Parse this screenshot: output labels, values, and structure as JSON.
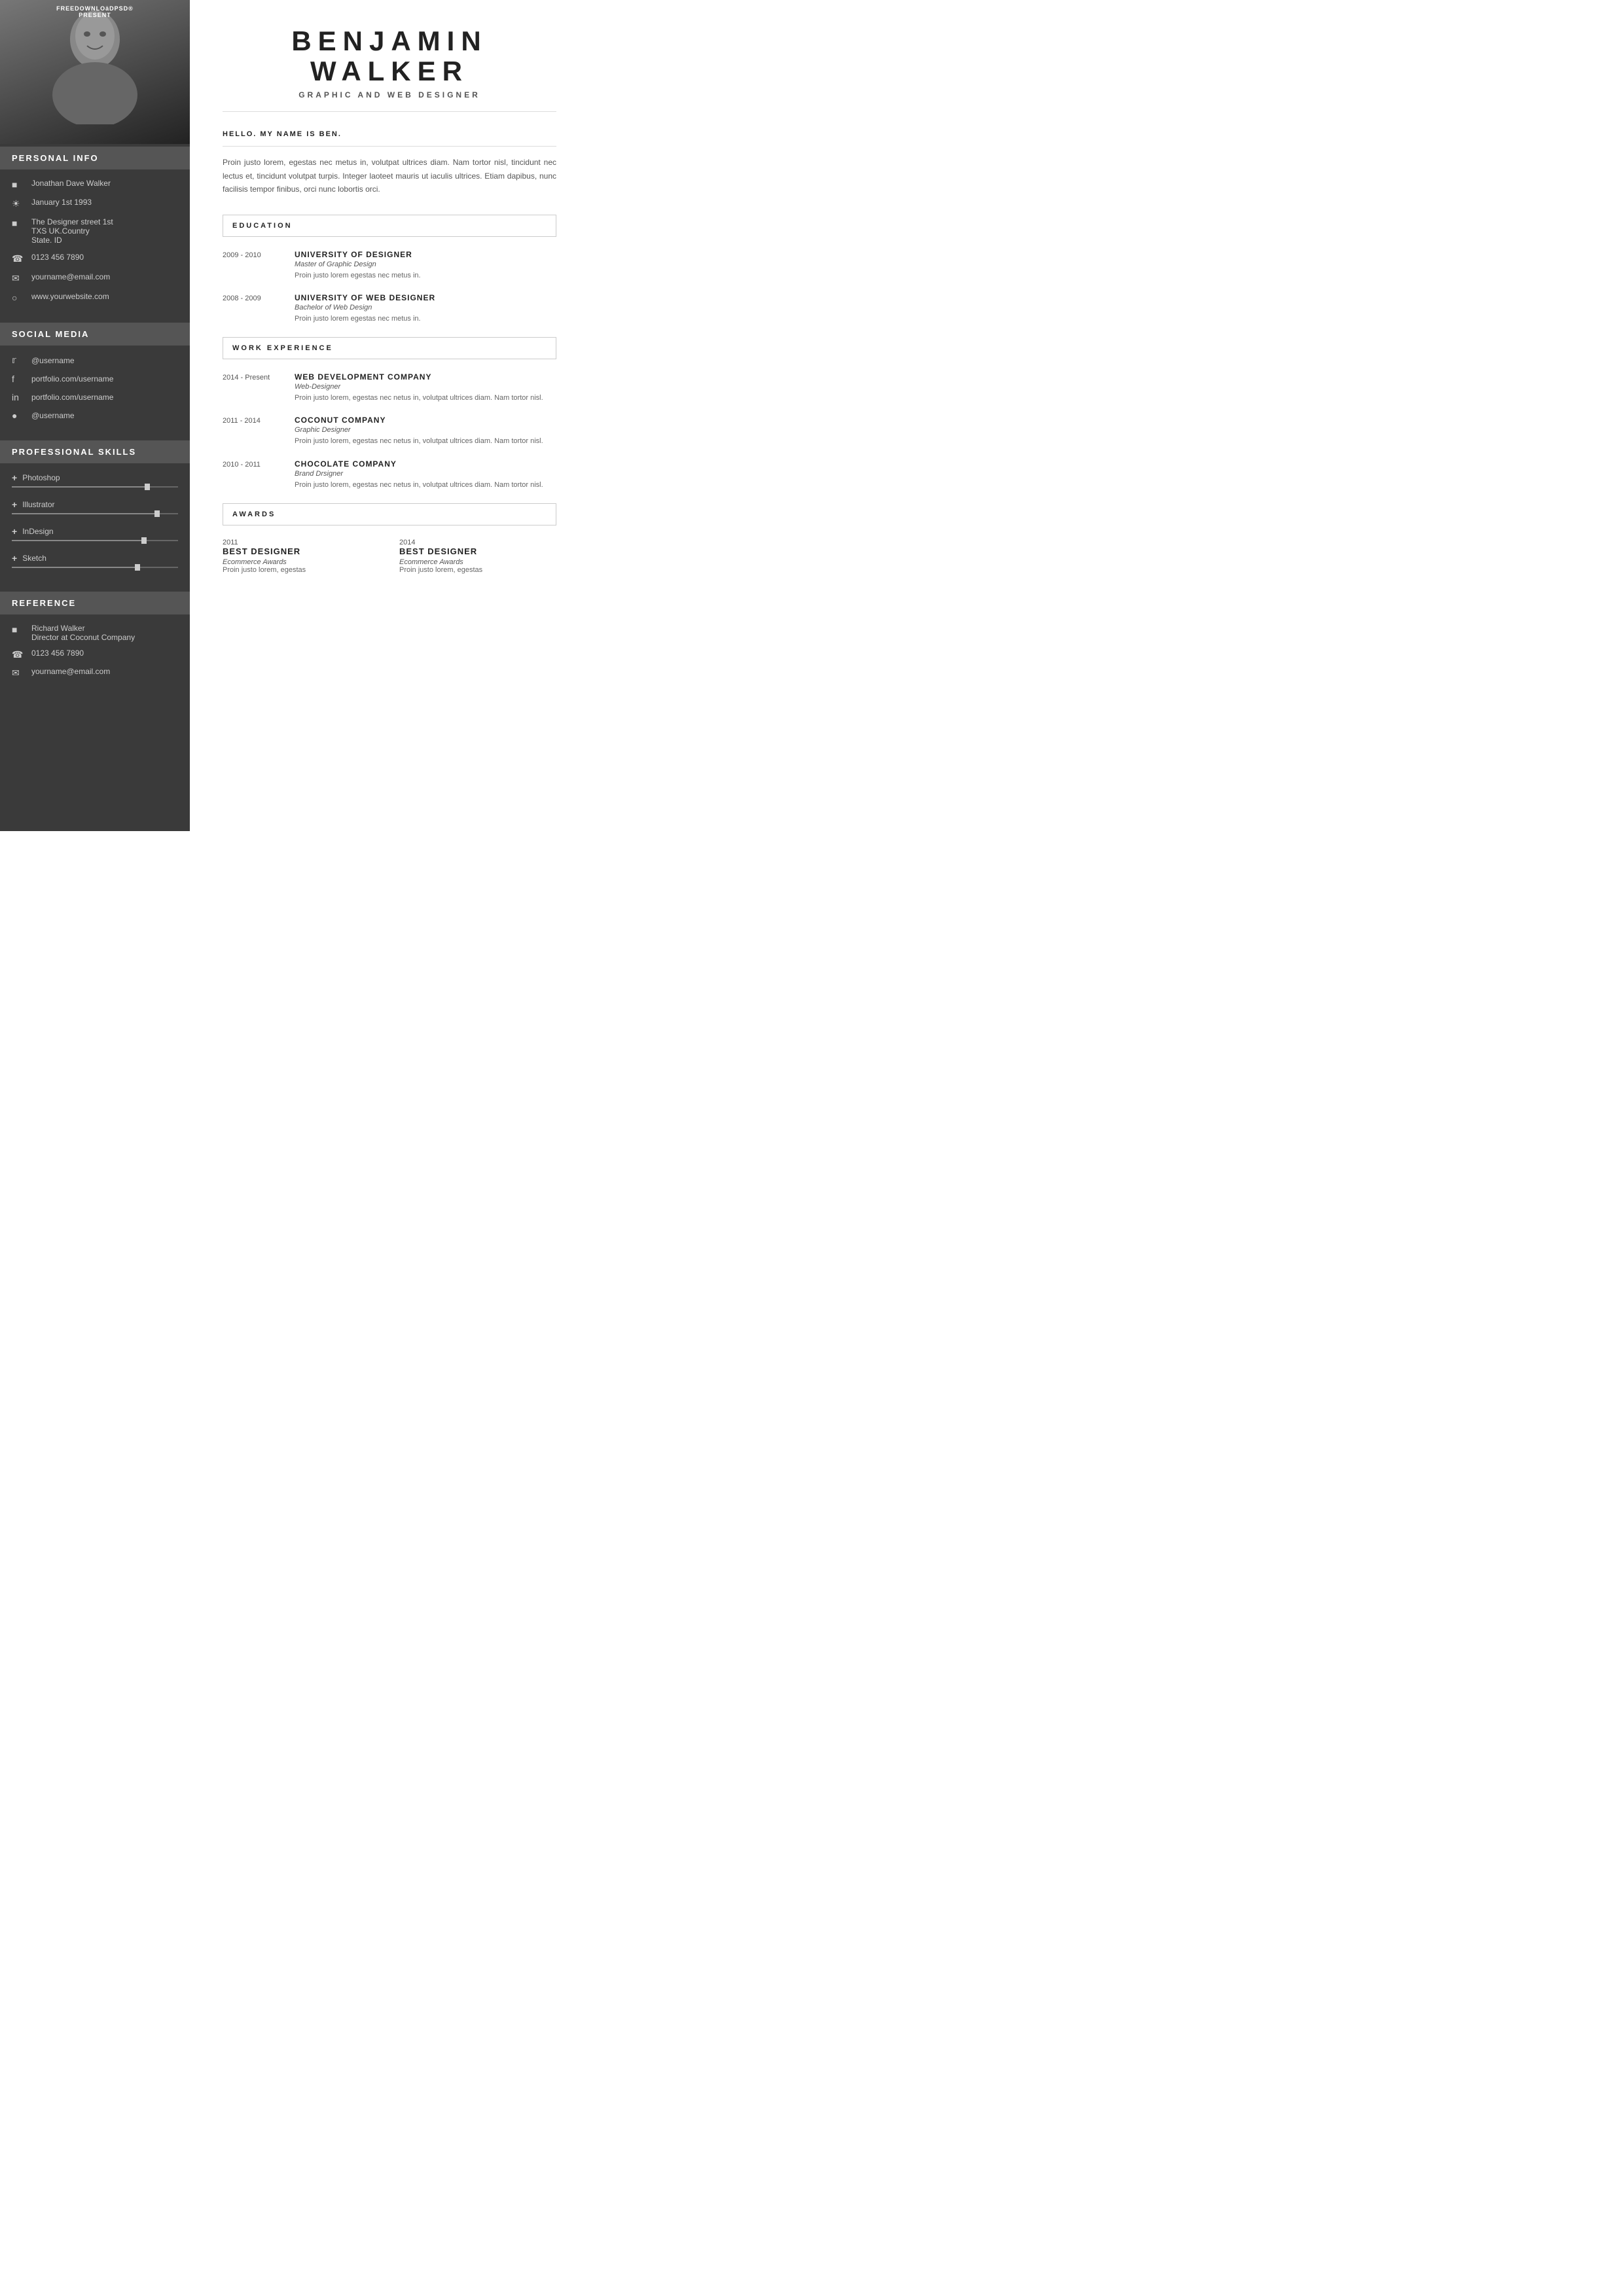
{
  "watermark": {
    "line1": "FREEDOWNLOäDPSD®",
    "line2": "PRESENT"
  },
  "sidebar": {
    "sections": {
      "personal_info": "PERSONAL INFO",
      "social_media": "SOCIAL MEDIA",
      "professional_skills": "PROFESSIONAL  SKILLS",
      "reference": "REFERENCE"
    },
    "personal": {
      "name": "Jonathan Dave Walker",
      "dob": "January 1st 1993",
      "address_line1": "The Designer street 1st",
      "address_line2": "TXS UK.Country",
      "address_line3": "State. ID",
      "phone": "0123 456 7890",
      "email": "yourname@email.com",
      "website": "www.yourwebsite.com"
    },
    "social": {
      "twitter": "@username",
      "facebook": "portfolio.com/username",
      "linkedin": "portfolio.com/username",
      "instagram": "@username"
    },
    "skills": [
      {
        "name": "Photoshop",
        "level": 82
      },
      {
        "name": "Illustrator",
        "level": 88
      },
      {
        "name": "InDesign",
        "level": 80
      },
      {
        "name": "Sketch",
        "level": 76
      }
    ],
    "reference": {
      "name": "Richard Walker",
      "title": "Director at Coconut Company",
      "phone": "0123 456 7890",
      "email": "yourname@email.com"
    }
  },
  "main": {
    "first_name": "BENJAMIN",
    "last_name": "WALKER",
    "job_title": "GRAPHIC AND WEB DESIGNER",
    "greeting": "HELLO. MY NAME IS BEN.",
    "intro": "Proin justo lorem, egestas nec metus in, volutpat ultrices diam. Nam tortor nisl, tincidunt nec lectus et, tincidunt volutpat turpis. Integer laoteet mauris ut iaculis ultrices. Etiam dapibus, nunc facilisis tempor finibus, orci nunc lobortis orci.",
    "education": {
      "title": "EDUCATION",
      "items": [
        {
          "years": "2009 - 2010",
          "org": "UNIVERSITY OF DESIGNER",
          "degree": "Master of Graphic Design",
          "desc": "Proin justo lorem egestas nec metus in."
        },
        {
          "years": "2008 - 2009",
          "org": "UNIVERSITY OF WEB DESIGNER",
          "degree": "Bachelor of Web Design",
          "desc": "Proin justo lorem egestas nec metus in."
        }
      ]
    },
    "work_experience": {
      "title": "WORK EXPERIENCE",
      "items": [
        {
          "years": "2014 - Present",
          "org": "WEB DEVELOPMENT COMPANY",
          "role": "Web-Designer",
          "desc": "Proin justo lorem, egestas nec netus in, volutpat ultrices diam. Nam tortor nisl."
        },
        {
          "years": "2011 - 2014",
          "org": "COCONUT COMPANY",
          "role": "Graphic Designer",
          "desc": "Proin justo lorem, egestas nec netus in, volutpat ultrices diam. Nam tortor nisl."
        },
        {
          "years": "2010 - 2011",
          "org": "CHOCOLATE  COMPANY",
          "role": "Brand Drsigner",
          "desc": "Proin justo lorem, egestas nec netus in, volutpat ultrices diam. Nam tortor nisl."
        }
      ]
    },
    "awards": {
      "title": "AWARDS",
      "items": [
        {
          "year": "2011",
          "title": "BEST  DESIGNER",
          "org": "Ecommerce Awards",
          "desc": "Proin justo  lorem, egestas"
        },
        {
          "year": "2014",
          "title": "BEST  DESIGNER",
          "org": "Ecommerce Awards",
          "desc": "Proin justo  lorem, egestas"
        }
      ]
    }
  }
}
